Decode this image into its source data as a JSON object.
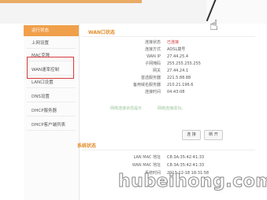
{
  "sidebar": {
    "items": [
      {
        "label": "运行状态"
      },
      {
        "label": "上网设置"
      },
      {
        "label": "MAC克隆"
      },
      {
        "label": "WAN速率控制"
      },
      {
        "label": "LAN口设置"
      },
      {
        "label": "DNS设置"
      },
      {
        "label": "DHCP服务器"
      },
      {
        "label": "DHCP客户端列表"
      }
    ]
  },
  "wan": {
    "title": "WAN口状态",
    "rows": [
      {
        "label": "连接状态",
        "value": "已连接"
      },
      {
        "label": "连接方式",
        "value": "ADSL拨号"
      },
      {
        "label": "WAN IP",
        "value": "27.44.25.4"
      },
      {
        "label": "子网掩码",
        "value": "255.255.255.255"
      },
      {
        "label": "网关",
        "value": "27.44.24.1"
      },
      {
        "label": "首选服务器",
        "value": "221.5.88.88"
      },
      {
        "label": "备用域名服务器",
        "value": "210.21.196.6"
      },
      {
        "label": "连接时间",
        "value": "04:43:08"
      }
    ],
    "status_label": "网络连接状态提示",
    "status_value": "网络连接成功。",
    "connect_button": "连 接",
    "disconnect_button": "断 开"
  },
  "system": {
    "title": "系统状态",
    "rows": [
      {
        "label": "LAN MAC 地址",
        "value": "C8:3A:35:42:41:33"
      },
      {
        "label": "WAN MAC 地址",
        "value": "C8:3A:35:42:41:33"
      },
      {
        "label": "系统时间",
        "value": "2013-12-18 18:31:58"
      }
    ]
  },
  "watermark": "hubeihong.com",
  "colors": {
    "accent": "#e48c2a",
    "active": "#f0a04b",
    "highlight": "#d63b3b"
  }
}
